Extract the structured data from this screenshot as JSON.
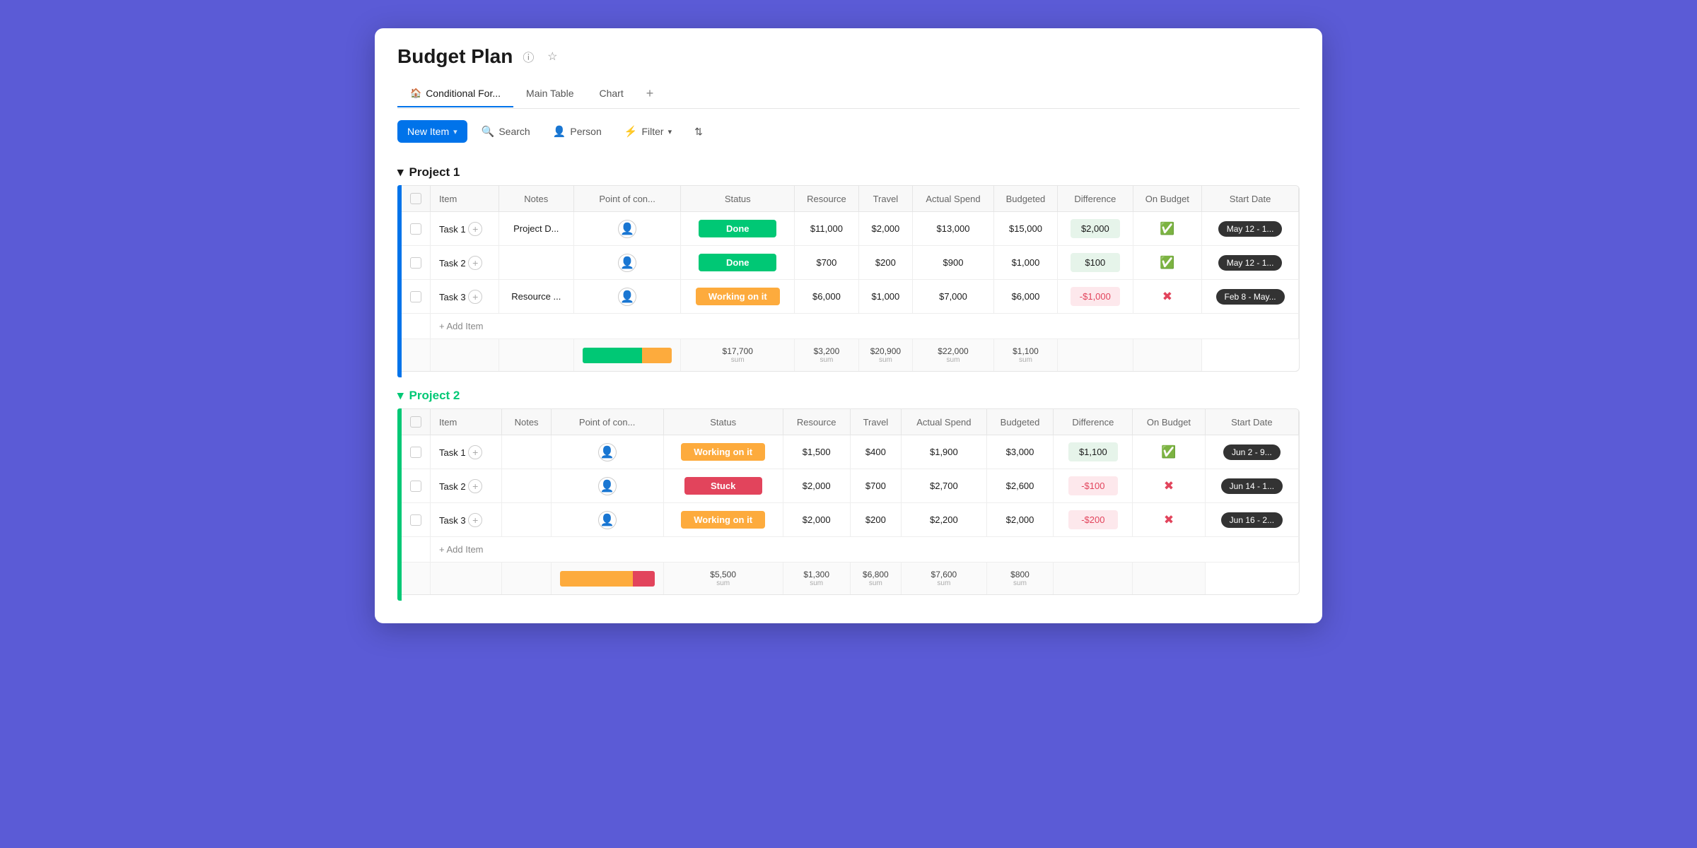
{
  "page": {
    "title": "Budget Plan",
    "tabs": [
      {
        "id": "conditional",
        "label": "Conditional For...",
        "icon": "🏠",
        "active": true
      },
      {
        "id": "main",
        "label": "Main Table",
        "active": false
      },
      {
        "id": "chart",
        "label": "Chart",
        "active": false
      }
    ],
    "toolbar": {
      "new_item": "New Item",
      "search": "Search",
      "person": "Person",
      "filter": "Filter",
      "sort_icon": "⇅"
    }
  },
  "groups": [
    {
      "id": "project1",
      "name": "Project 1",
      "color": "#0073ea",
      "columns": [
        "Item",
        "Notes",
        "Point of con...",
        "Status",
        "Resource",
        "Travel",
        "Actual Spend",
        "Budgeted",
        "Difference",
        "On Budget",
        "Start Date"
      ],
      "rows": [
        {
          "item": "Task 1",
          "notes": "Project D...",
          "status": "Done",
          "status_type": "done",
          "resource": "$11,000",
          "travel": "$2,000",
          "actual_spend": "$13,000",
          "budgeted": "$15,000",
          "difference": "$2,000",
          "diff_type": "positive",
          "on_budget": true,
          "date": "May 12 - 1..."
        },
        {
          "item": "Task 2",
          "notes": "",
          "status": "Done",
          "status_type": "done",
          "resource": "$700",
          "travel": "$200",
          "actual_spend": "$900",
          "budgeted": "$1,000",
          "difference": "$100",
          "diff_type": "positive",
          "on_budget": true,
          "date": "May 12 - 1..."
        },
        {
          "item": "Task 3",
          "notes": "Resource ...",
          "status": "Working on it",
          "status_type": "working",
          "resource": "$6,000",
          "travel": "$1,000",
          "actual_spend": "$7,000",
          "budgeted": "$6,000",
          "difference": "-$1,000",
          "diff_type": "negative",
          "on_budget": false,
          "date": "Feb 8 - May..."
        }
      ],
      "sum": {
        "resource": "$17,700",
        "travel": "$3,200",
        "actual_spend": "$20,900",
        "budgeted": "$22,000",
        "difference": "$1,100"
      },
      "progress": [
        {
          "type": "green",
          "flex": 2
        },
        {
          "type": "orange",
          "flex": 1
        }
      ]
    },
    {
      "id": "project2",
      "name": "Project 2",
      "color": "#00c875",
      "columns": [
        "Item",
        "Notes",
        "Point of con...",
        "Status",
        "Resource",
        "Travel",
        "Actual Spend",
        "Budgeted",
        "Difference",
        "On Budget",
        "Start Date"
      ],
      "rows": [
        {
          "item": "Task 1",
          "notes": "",
          "status": "Working on it",
          "status_type": "working",
          "resource": "$1,500",
          "travel": "$400",
          "actual_spend": "$1,900",
          "budgeted": "$3,000",
          "difference": "$1,100",
          "diff_type": "positive",
          "on_budget": true,
          "date": "Jun 2 - 9..."
        },
        {
          "item": "Task 2",
          "notes": "",
          "status": "Stuck",
          "status_type": "stuck",
          "resource": "$2,000",
          "travel": "$700",
          "actual_spend": "$2,700",
          "budgeted": "$2,600",
          "difference": "-$100",
          "diff_type": "negative",
          "on_budget": false,
          "date": "Jun 14 - 1..."
        },
        {
          "item": "Task 3",
          "notes": "",
          "status": "Working on it",
          "status_type": "working",
          "resource": "$2,000",
          "travel": "$200",
          "actual_spend": "$2,200",
          "budgeted": "$2,000",
          "difference": "-$200",
          "diff_type": "negative",
          "on_budget": false,
          "date": "Jun 16 - 2..."
        }
      ],
      "sum": {
        "resource": "$5,500",
        "travel": "$1,300",
        "actual_spend": "$6,800",
        "budgeted": "$7,600",
        "difference": "$800"
      },
      "progress": [
        {
          "type": "orange",
          "flex": 2
        },
        {
          "type": "red",
          "flex": 1
        }
      ]
    }
  ]
}
